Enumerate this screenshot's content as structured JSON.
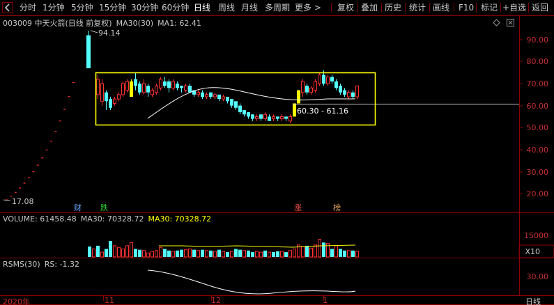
{
  "toolbar": {
    "periods": [
      "分时",
      "1分钟",
      "5分钟",
      "15分钟",
      "30分钟",
      "60分钟",
      "日线",
      "周线",
      "月线",
      "多周期",
      "更多 >"
    ],
    "active_period": "日线",
    "tools": [
      "复权",
      "叠加",
      "历史",
      "统计",
      "画线",
      "F10",
      "标记",
      "+自选",
      "返回"
    ]
  },
  "main_panel": {
    "header": {
      "stock": "003009 中天火箭(日线 前复权)",
      "ma30": "MA30(30)",
      "ma1": "MA1: 62.41"
    },
    "y_labels": [
      "90.00",
      "80.00",
      "70.00",
      "60.00",
      "50.00",
      "40.00",
      "30.00",
      "20.00"
    ],
    "high_label": "94.14",
    "low_label": "17.08",
    "range_label": "60.30 - 61.16",
    "event_tags": [
      "财",
      "跌",
      "涨",
      "榜"
    ]
  },
  "volume_panel": {
    "header": {
      "volume": "VOLUME: 61458.48",
      "ma30_a": "MA30: 70328.72",
      "ma30_b": "MA30: 70328.72"
    },
    "y_label": "15000",
    "unit_label": "X10"
  },
  "rsms_panel": {
    "header": {
      "name": "RSMS(30)",
      "value": "RS: -1.32"
    },
    "y_label": "30.00"
  },
  "x_axis": {
    "labels": [
      "2020年",
      "11",
      "12",
      "1"
    ],
    "period_label": "日线"
  },
  "colors": {
    "up": "#ff3232",
    "down": "#54ffff",
    "highlight_box": "#ffff00",
    "ma_line": "#ffffff",
    "vol_ma": "#ffff00",
    "axis_text": "#c83030",
    "border": "#8b0000",
    "header_white": "#c8c8c8",
    "header_yellow": "#ffff00"
  }
}
